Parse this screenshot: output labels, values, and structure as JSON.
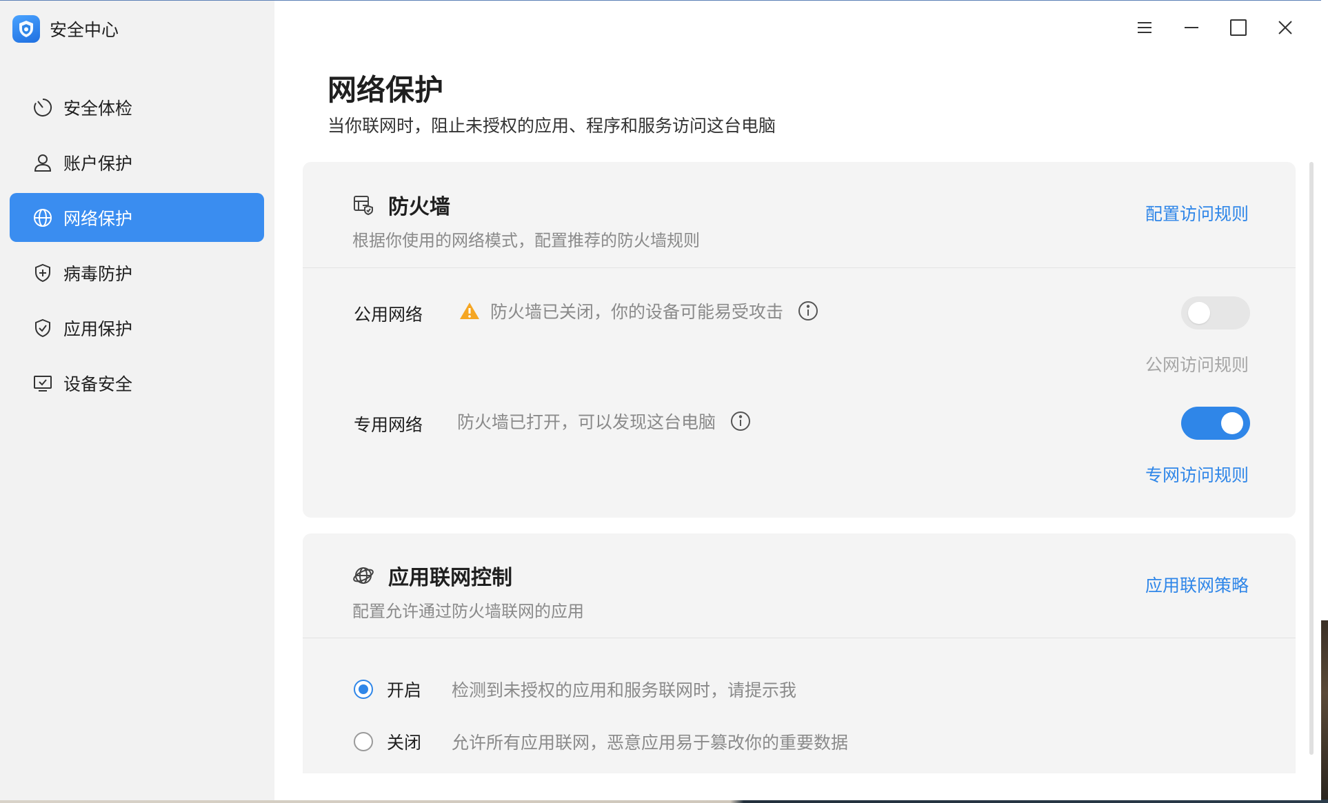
{
  "app": {
    "title": "安全中心"
  },
  "sidebar": {
    "items": [
      {
        "label": "安全体检",
        "icon": "scan-icon",
        "active": false
      },
      {
        "label": "账户保护",
        "icon": "user-icon",
        "active": false
      },
      {
        "label": "网络保护",
        "icon": "globe-icon",
        "active": true
      },
      {
        "label": "病毒防护",
        "icon": "shield-plus-icon",
        "active": false
      },
      {
        "label": "应用保护",
        "icon": "shield-check-icon",
        "active": false
      },
      {
        "label": "设备安全",
        "icon": "monitor-check-icon",
        "active": false
      }
    ]
  },
  "window_controls": [
    "menu-icon",
    "minimize-icon",
    "maximize-icon",
    "close-icon"
  ],
  "page": {
    "title": "网络保护",
    "subtitle": "当你联网时，阻止未授权的应用、程序和服务访问这台电脑"
  },
  "firewall": {
    "title": "防火墙",
    "desc": "根据你使用的网络模式，配置推荐的防火墙规则",
    "link": "配置访问规则",
    "public": {
      "label": "公用网络",
      "status": "防火墙已关闭，你的设备可能易受攻击",
      "enabled": false,
      "rules_link": "公网访问规则"
    },
    "private": {
      "label": "专用网络",
      "status": "防火墙已打开，可以发现这台电脑",
      "enabled": true,
      "rules_link": "专网访问规则"
    }
  },
  "app_control": {
    "title": "应用联网控制",
    "desc": "配置允许通过防火墙联网的应用",
    "link": "应用联网策略",
    "options": [
      {
        "label": "开启",
        "desc": "检测到未授权的应用和服务联网时，请提示我",
        "checked": true
      },
      {
        "label": "关闭",
        "desc": "允许所有应用联网，恶意应用易于篡改你的重要数据",
        "checked": false
      }
    ]
  },
  "colors": {
    "accent": "#2f86e8",
    "sidebar_active": "#3a8df0",
    "warning": "#f5a623"
  }
}
